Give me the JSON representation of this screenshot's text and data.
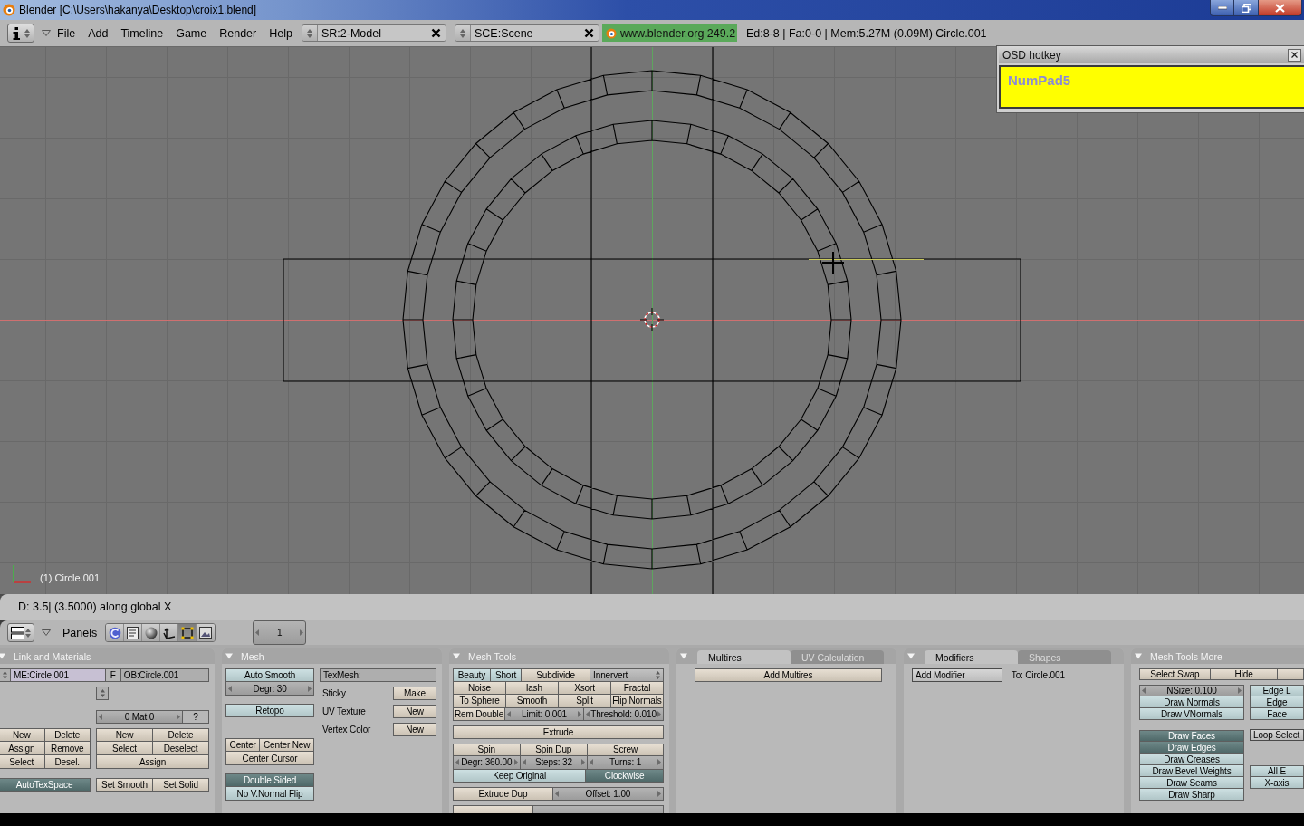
{
  "window": {
    "title": "Blender [C:\\Users\\hakanya\\Desktop\\croix1.blend]"
  },
  "header": {
    "menus": [
      "File",
      "Add",
      "Timeline",
      "Game",
      "Render",
      "Help"
    ],
    "screen": "SR:2-Model",
    "scene": "SCE:Scene",
    "version": "www.blender.org 249.2",
    "stats": "Ed:8-8 | Fa:0-0 | Mem:5.27M (0.09M) Circle.001"
  },
  "osd": {
    "title": "OSD hotkey",
    "key": "NumPad5"
  },
  "viewport": {
    "object_label": "(1) Circle.001"
  },
  "info_bar": {
    "text": "D: 3.5| (3.5000) along global X"
  },
  "buttons_header": {
    "label": "Panels",
    "contexts": [
      {
        "kind": "logic",
        "selected": false
      },
      {
        "kind": "script",
        "selected": false
      },
      {
        "kind": "shading",
        "selected": false
      },
      {
        "kind": "object",
        "selected": false
      },
      {
        "kind": "editing",
        "selected": true
      },
      {
        "kind": "scene",
        "selected": false
      }
    ],
    "frame": "1"
  },
  "panels": [
    {
      "title": "Link and Materials",
      "sections": [
        [
          [
            [
              [
                {
                  "kind": "spinner"
                },
                {
                  "kind": "id_field",
                  "label": "ME:Circle.001"
                },
                {
                  "kind": "plain",
                  "label": "F"
                },
                {
                  "kind": "field",
                  "label": "OB:Circle.001"
                }
              ]
            ]
          ]
        ],
        [
          [
            [
              [
                {
                  "kind": "action",
                  "label": "New"
                },
                {
                  "kind": "action",
                  "label": "Delete"
                }
              ],
              [
                {
                  "kind": "action",
                  "label": "Assign"
                },
                {
                  "kind": "action",
                  "label": "Remove"
                }
              ],
              [
                {
                  "kind": "action",
                  "label": "Select"
                },
                {
                  "kind": "action",
                  "label": "Desel."
                }
              ]
            ],
            [
              [
                {
                  "kind": "toggle",
                  "label": "AutoTexSpace",
                  "on": true
                }
              ]
            ]
          ],
          [
            [
              [
                {
                  "kind": "spinner"
                }
              ]
            ],
            [
              [
                {
                  "kind": "number",
                  "label": "0 Mat 0"
                },
                {
                  "kind": "plain",
                  "label": "?"
                }
              ]
            ],
            [
              [
                {
                  "kind": "action",
                  "label": "New"
                },
                {
                  "kind": "action",
                  "label": "Delete"
                }
              ],
              [
                {
                  "kind": "action",
                  "label": "Select"
                },
                {
                  "kind": "action",
                  "label": "Deselect"
                }
              ],
              [
                {
                  "kind": "action",
                  "label": "Assign"
                }
              ]
            ],
            [
              [
                {
                  "kind": "action",
                  "label": "Set Smooth"
                },
                {
                  "kind": "action",
                  "label": "Set Solid"
                }
              ]
            ]
          ]
        ]
      ]
    },
    {
      "title": "Mesh",
      "sections": [
        [
          [
            [
              [
                {
                  "kind": "toggle",
                  "label": "Auto Smooth",
                  "on": false
                }
              ],
              [
                {
                  "kind": "number",
                  "label": "Degr: 30"
                }
              ]
            ],
            [
              [
                {
                  "kind": "toggle",
                  "label": "Retopo",
                  "on": false
                }
              ]
            ],
            [
              [
                {
                  "kind": "action",
                  "label": "Center"
                },
                {
                  "kind": "action",
                  "label": "Center New"
                }
              ],
              [
                {
                  "kind": "action",
                  "label": "Center Cursor"
                }
              ]
            ],
            [
              [
                {
                  "kind": "toggle",
                  "label": "Double Sided",
                  "on": true
                }
              ],
              [
                {
                  "kind": "toggle",
                  "label": "No V.Normal Flip",
                  "on": false
                }
              ]
            ]
          ],
          [
            [
              [
                {
                  "kind": "field",
                  "label": "TexMesh:"
                }
              ]
            ],
            [
              [
                {
                  "kind": "label",
                  "label": "Sticky"
                },
                {
                  "kind": "action",
                  "label": "Make"
                }
              ]
            ],
            [
              [
                {
                  "kind": "label",
                  "label": "UV Texture"
                },
                {
                  "kind": "action",
                  "label": "New"
                }
              ]
            ],
            [
              [
                {
                  "kind": "label",
                  "label": "Vertex Color"
                },
                {
                  "kind": "action",
                  "label": "New"
                }
              ]
            ]
          ]
        ]
      ]
    },
    {
      "title": "Mesh Tools",
      "sections": [
        [
          [
            [
              [
                {
                  "kind": "toggle",
                  "label": "Beauty",
                  "on": false
                },
                {
                  "kind": "toggle",
                  "label": "Short",
                  "on": false
                },
                {
                  "kind": "action",
                  "label": "Subdivide"
                },
                {
                  "kind": "dropdown",
                  "label": "Innervert"
                }
              ],
              [
                {
                  "kind": "action",
                  "label": "Noise"
                },
                {
                  "kind": "action",
                  "label": "Hash"
                },
                {
                  "kind": "action",
                  "label": "Xsort"
                },
                {
                  "kind": "action",
                  "label": "Fractal"
                }
              ],
              [
                {
                  "kind": "action",
                  "label": "To Sphere"
                },
                {
                  "kind": "action",
                  "label": "Smooth"
                },
                {
                  "kind": "action",
                  "label": "Split"
                },
                {
                  "kind": "action",
                  "label": "Flip Normals"
                }
              ],
              [
                {
                  "kind": "action",
                  "label": "Rem Double"
                },
                {
                  "kind": "number",
                  "label": "Limit: 0.001"
                },
                {
                  "kind": "number",
                  "label": "Threshold: 0.010"
                }
              ]
            ],
            [
              [
                {
                  "kind": "action",
                  "label": "Extrude"
                }
              ]
            ],
            [
              [
                {
                  "kind": "action",
                  "label": "Spin"
                },
                {
                  "kind": "action",
                  "label": "Spin Dup"
                },
                {
                  "kind": "action",
                  "label": "Screw"
                }
              ],
              [
                {
                  "kind": "number",
                  "label": "Degr: 360.00"
                },
                {
                  "kind": "number",
                  "label": "Steps: 32"
                },
                {
                  "kind": "number",
                  "label": "Turns: 1"
                }
              ],
              [
                {
                  "kind": "toggle",
                  "label": "Keep Original",
                  "on": false
                },
                {
                  "kind": "toggle",
                  "label": "Clockwise",
                  "on": true
                }
              ]
            ],
            [
              [
                {
                  "kind": "action",
                  "label": "Extrude Dup"
                },
                {
                  "kind": "number",
                  "label": "Offset: 1.00"
                }
              ]
            ],
            [
              [
                {
                  "kind": "action"
                },
                {
                  "kind": "number"
                }
              ]
            ]
          ]
        ]
      ]
    },
    {
      "tabs": [
        {
          "label": "Multires",
          "selected": true
        },
        {
          "label": "UV Calculation",
          "selected": false
        }
      ],
      "sections": [
        [
          [
            [
              [
                {
                  "kind": "action",
                  "label": "Add Multires"
                }
              ]
            ]
          ]
        ]
      ]
    },
    {
      "tabs": [
        {
          "label": "Modifiers",
          "selected": true
        },
        {
          "label": "Shapes",
          "selected": false
        }
      ],
      "sections": [
        [
          [
            [
              [
                {
                  "kind": "menu",
                  "label": "Add Modifier"
                },
                {
                  "kind": "label",
                  "label": "To: Circle.001"
                }
              ]
            ]
          ]
        ]
      ]
    },
    {
      "title": "Mesh Tools More",
      "sections": [
        [
          [
            [
              [
                {
                  "kind": "action",
                  "label": "Select Swap"
                },
                {
                  "kind": "action",
                  "label": "Hide"
                },
                {
                  "kind": "action"
                }
              ]
            ]
          ]
        ],
        [
          [
            [
              [
                {
                  "kind": "number",
                  "label": "NSize: 0.100"
                }
              ],
              [
                {
                  "kind": "toggle",
                  "label": "Draw Normals",
                  "on": false
                }
              ],
              [
                {
                  "kind": "toggle",
                  "label": "Draw VNormals",
                  "on": false
                }
              ]
            ],
            [
              [
                {
                  "kind": "toggle",
                  "label": "Draw Faces",
                  "on": true
                }
              ],
              [
                {
                  "kind": "toggle",
                  "label": "Draw Edges",
                  "on": true
                }
              ],
              [
                {
                  "kind": "toggle",
                  "label": "Draw Creases",
                  "on": false
                }
              ],
              [
                {
                  "kind": "toggle",
                  "label": "Draw Bevel Weights",
                  "on": false
                }
              ],
              [
                {
                  "kind": "toggle",
                  "label": "Draw Seams",
                  "on": false
                }
              ],
              [
                {
                  "kind": "toggle",
                  "label": "Draw Sharp",
                  "on": false
                }
              ]
            ]
          ],
          [
            [
              [
                {
                  "kind": "toggle",
                  "label": "Edge L",
                  "on": false
                }
              ],
              [
                {
                  "kind": "toggle",
                  "label": "Edge",
                  "on": false
                }
              ],
              [
                {
                  "kind": "toggle",
                  "label": "Face",
                  "on": false
                }
              ]
            ],
            [
              [
                {
                  "kind": "menu",
                  "label": "Loop Select"
                }
              ]
            ],
            [
              [
                {
                  "kind": "toggle",
                  "label": "All E",
                  "on": false
                }
              ],
              [
                {
                  "kind": "toggle",
                  "label": "X-axis",
                  "on": false
                }
              ]
            ]
          ]
        ]
      ]
    }
  ]
}
